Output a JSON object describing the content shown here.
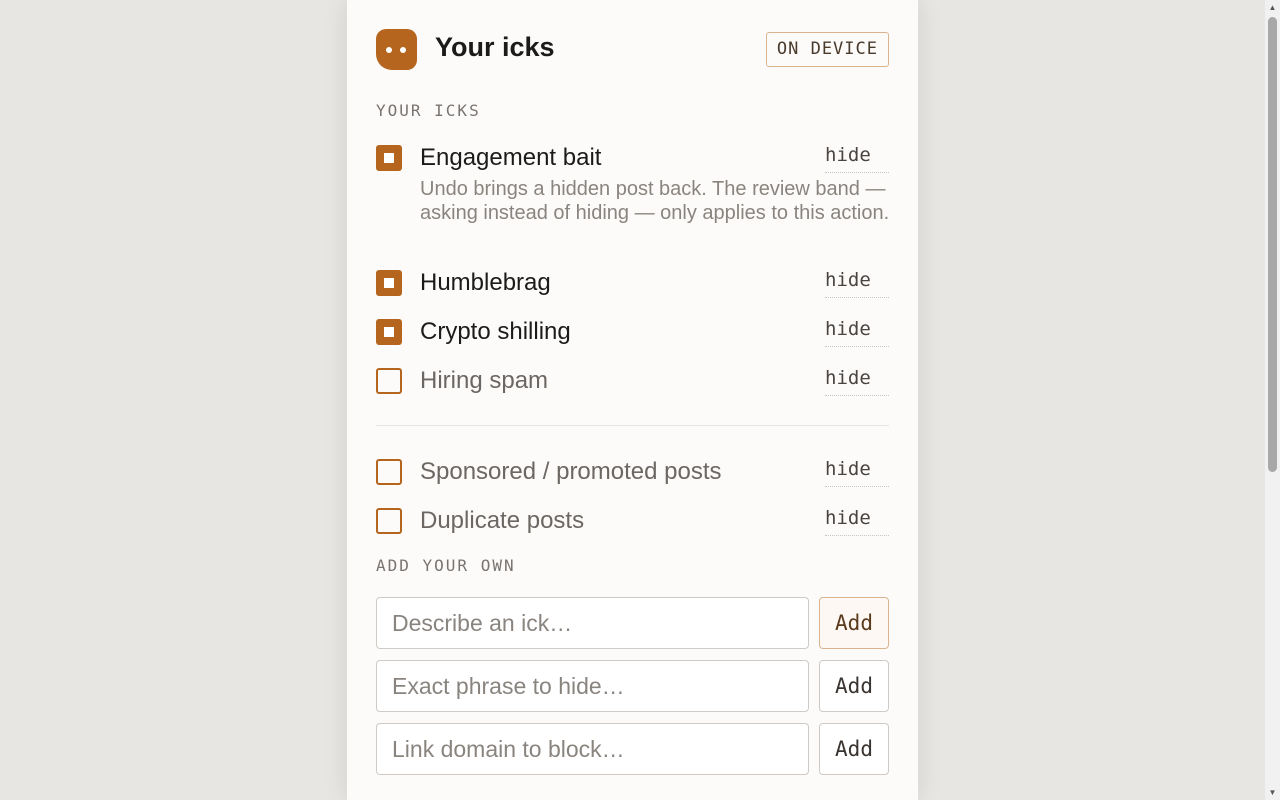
{
  "header": {
    "title": "Your icks",
    "badge": "ON DEVICE",
    "logo_icon": "ghost-face-icon"
  },
  "sections": {
    "icks_label": "YOUR ICKS",
    "add_label": "ADD YOUR OWN"
  },
  "icks": [
    {
      "label": "Engagement bait",
      "checked": true,
      "action": "hide",
      "description": "Undo brings a hidden post back. The review band — asking instead of hiding — only applies to this action."
    },
    {
      "label": "Humblebrag",
      "checked": true,
      "action": "hide"
    },
    {
      "label": "Crypto shilling",
      "checked": true,
      "action": "hide"
    },
    {
      "label": "Hiring spam",
      "checked": false,
      "action": "hide"
    }
  ],
  "extras": [
    {
      "label": "Sponsored / promoted posts",
      "checked": false,
      "action": "hide"
    },
    {
      "label": "Duplicate posts",
      "checked": false,
      "action": "hide"
    }
  ],
  "add": [
    {
      "placeholder": "Describe an ick…",
      "button": "Add"
    },
    {
      "placeholder": "Exact phrase to hide…",
      "button": "Add"
    },
    {
      "placeholder": "Link domain to block…",
      "button": "Add"
    }
  ],
  "colors": {
    "accent": "#b5651d",
    "background": "#e8e6e2",
    "panel": "#fcfbfa"
  }
}
